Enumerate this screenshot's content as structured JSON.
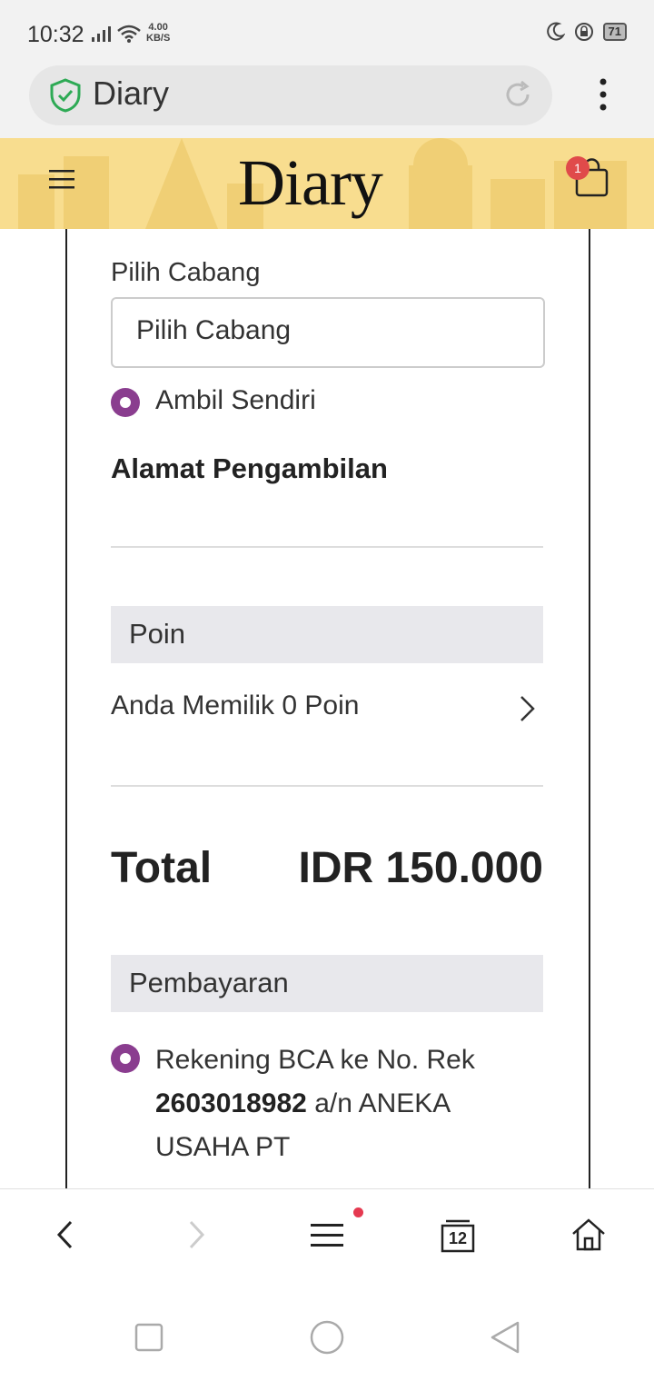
{
  "status_bar": {
    "time": "10:32",
    "speed_value": "4.00",
    "speed_unit": "KB/S",
    "battery": "71"
  },
  "browser": {
    "url_title": "Diary"
  },
  "site": {
    "logo": "Diary",
    "cart_count": "1"
  },
  "form": {
    "branch_label": "Pilih Cabang",
    "branch_select_value": "Pilih Cabang",
    "pickup_option": "Ambil Sendiri",
    "pickup_address_heading": "Alamat Pengambilan"
  },
  "points": {
    "section_title": "Poin",
    "message": "Anda Memilik 0 Poin"
  },
  "total": {
    "label": "Total",
    "value": "IDR 150.000"
  },
  "payment": {
    "section_title": "Pembayaran",
    "option_prefix": "Rekening BCA ke No. Rek",
    "account_number": "2603018982",
    "option_suffix": "a/n ANEKA USAHA PT"
  },
  "bottom_nav": {
    "tabs_count": "12"
  },
  "colors": {
    "header_bg": "#f8dd8f",
    "radio_accent": "#8a3d8f",
    "badge": "#e04a4a",
    "section_bg": "#e8e8ec"
  }
}
